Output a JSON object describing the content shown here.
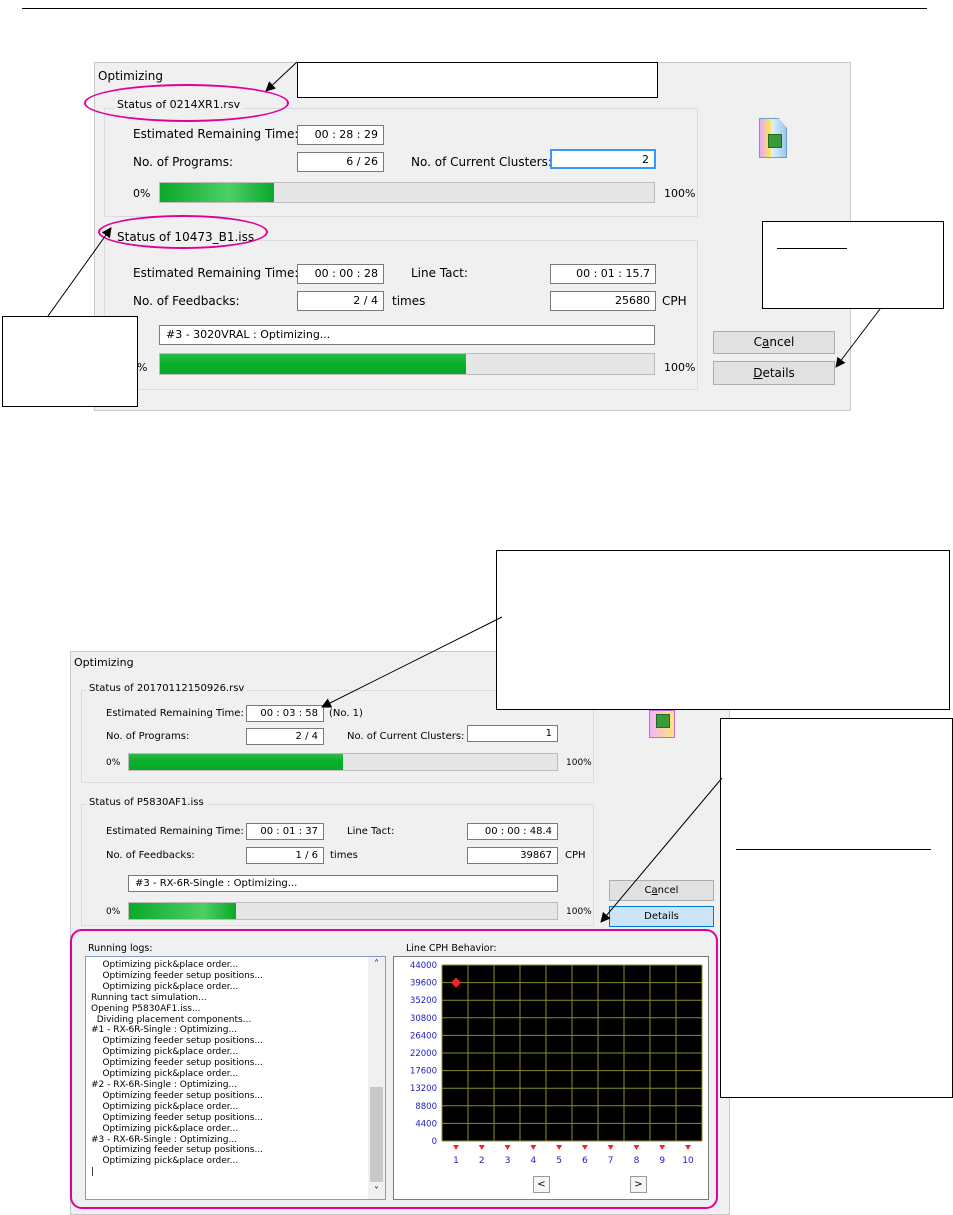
{
  "dialog1": {
    "title": "Optimizing",
    "group1": {
      "title": "Status of 0214XR1.rsv",
      "est_label": "Estimated Remaining Time:",
      "est_value": "00 : 28 : 29",
      "programs_label": "No. of Programs:",
      "programs_value": "6 / 26",
      "clusters_label": "No. of Current Clusters:",
      "clusters_value": "2",
      "progress_start": "0%",
      "progress_end": "100%",
      "progress": 0.23
    },
    "group2": {
      "title": "Status of 10473_B1.iss",
      "est_label": "Estimated Remaining Time:",
      "est_value": "00 : 00 : 28",
      "tact_label": "Line Tact:",
      "tact_value": "00 : 01 : 15.7",
      "feedback_label": "No. of Feedbacks:",
      "feedback_value": "2 / 4",
      "times_label": "times",
      "cph_value": "25680",
      "cph_label": "CPH",
      "status_text": "#3 - 3020VRAL : Optimizing...",
      "progress_start": "%",
      "progress_end": "100%",
      "progress": 0.62
    },
    "cancel_prefix": "C",
    "cancel_underlined": "a",
    "cancel_suffix": "ncel",
    "details_underlined": "D",
    "details_suffix": "etails",
    "callout_right_underlined": "———"
  },
  "dialog2": {
    "title": "Optimizing",
    "group1": {
      "title": "Status of 20170112150926.rsv",
      "est_label": "Estimated Remaining Time:",
      "est_value": "00 : 03 : 58",
      "est_note": "(No. 1)",
      "programs_label": "No. of Programs:",
      "programs_value": "2 / 4",
      "clusters_label": "No. of Current Clusters:",
      "clusters_value": "1",
      "progress_start": "0%",
      "progress_end": "100%",
      "progress": 0.5
    },
    "group2": {
      "title": "Status of P5830AF1.iss",
      "est_label": "Estimated Remaining Time:",
      "est_value": "00 : 01 : 37",
      "tact_label": "Line Tact:",
      "tact_value": "00 : 00 : 48.4",
      "feedback_label": "No. of Feedbacks:",
      "feedback_value": "1 / 6",
      "times_label": "times",
      "cph_value": "39867",
      "cph_label": "CPH",
      "status_text": "#3 - RX-6R-Single : Optimizing...",
      "progress_start": "0%",
      "progress_end": "100%",
      "progress": 0.25
    },
    "cancel_prefix": "C",
    "cancel_underlined": "a",
    "cancel_suffix": "ncel",
    "details_label": "Details",
    "logs_label": "Running logs:",
    "chart_label": "Line CPH Behavior:",
    "logs": [
      "    Optimizing pick&place order...",
      "    Optimizing feeder setup positions...",
      "    Optimizing pick&place order...",
      "Running tact simulation...",
      "Opening P5830AF1.iss...",
      "  Dividing placement components...",
      "#1 - RX-6R-Single : Optimizing...",
      "    Optimizing feeder setup positions...",
      "    Optimizing pick&place order...",
      "    Optimizing feeder setup positions...",
      "    Optimizing pick&place order...",
      "#2 - RX-6R-Single : Optimizing...",
      "    Optimizing feeder setup positions...",
      "    Optimizing pick&place order...",
      "    Optimizing feeder setup positions...",
      "    Optimizing pick&place order...",
      "#3 - RX-6R-Single : Optimizing...",
      "    Optimizing feeder setup positions...",
      "    Optimizing pick&place order...",
      "|"
    ],
    "scroll_up": "˄",
    "scroll_down": "˅",
    "nav_prev": "<",
    "nav_next": ">",
    "callout_underlined": "——————————"
  },
  "chart_data": {
    "type": "scatter",
    "title": "Line CPH Behavior:",
    "x": [
      1
    ],
    "y": [
      39600
    ],
    "x_ticks": [
      "1",
      "2",
      "3",
      "4",
      "5",
      "6",
      "7",
      "8",
      "9",
      "10"
    ],
    "y_ticks": [
      "44000",
      "39600",
      "35200",
      "30800",
      "26400",
      "22000",
      "17600",
      "13200",
      "8800",
      "4400",
      "0"
    ],
    "xlim": [
      1,
      10
    ],
    "ylim": [
      0,
      44000
    ],
    "grid": true,
    "colors": {
      "background": "#000000",
      "grid": "#8a8a2a",
      "marker": "#ff2020",
      "tick_text": "#2020c0"
    }
  }
}
